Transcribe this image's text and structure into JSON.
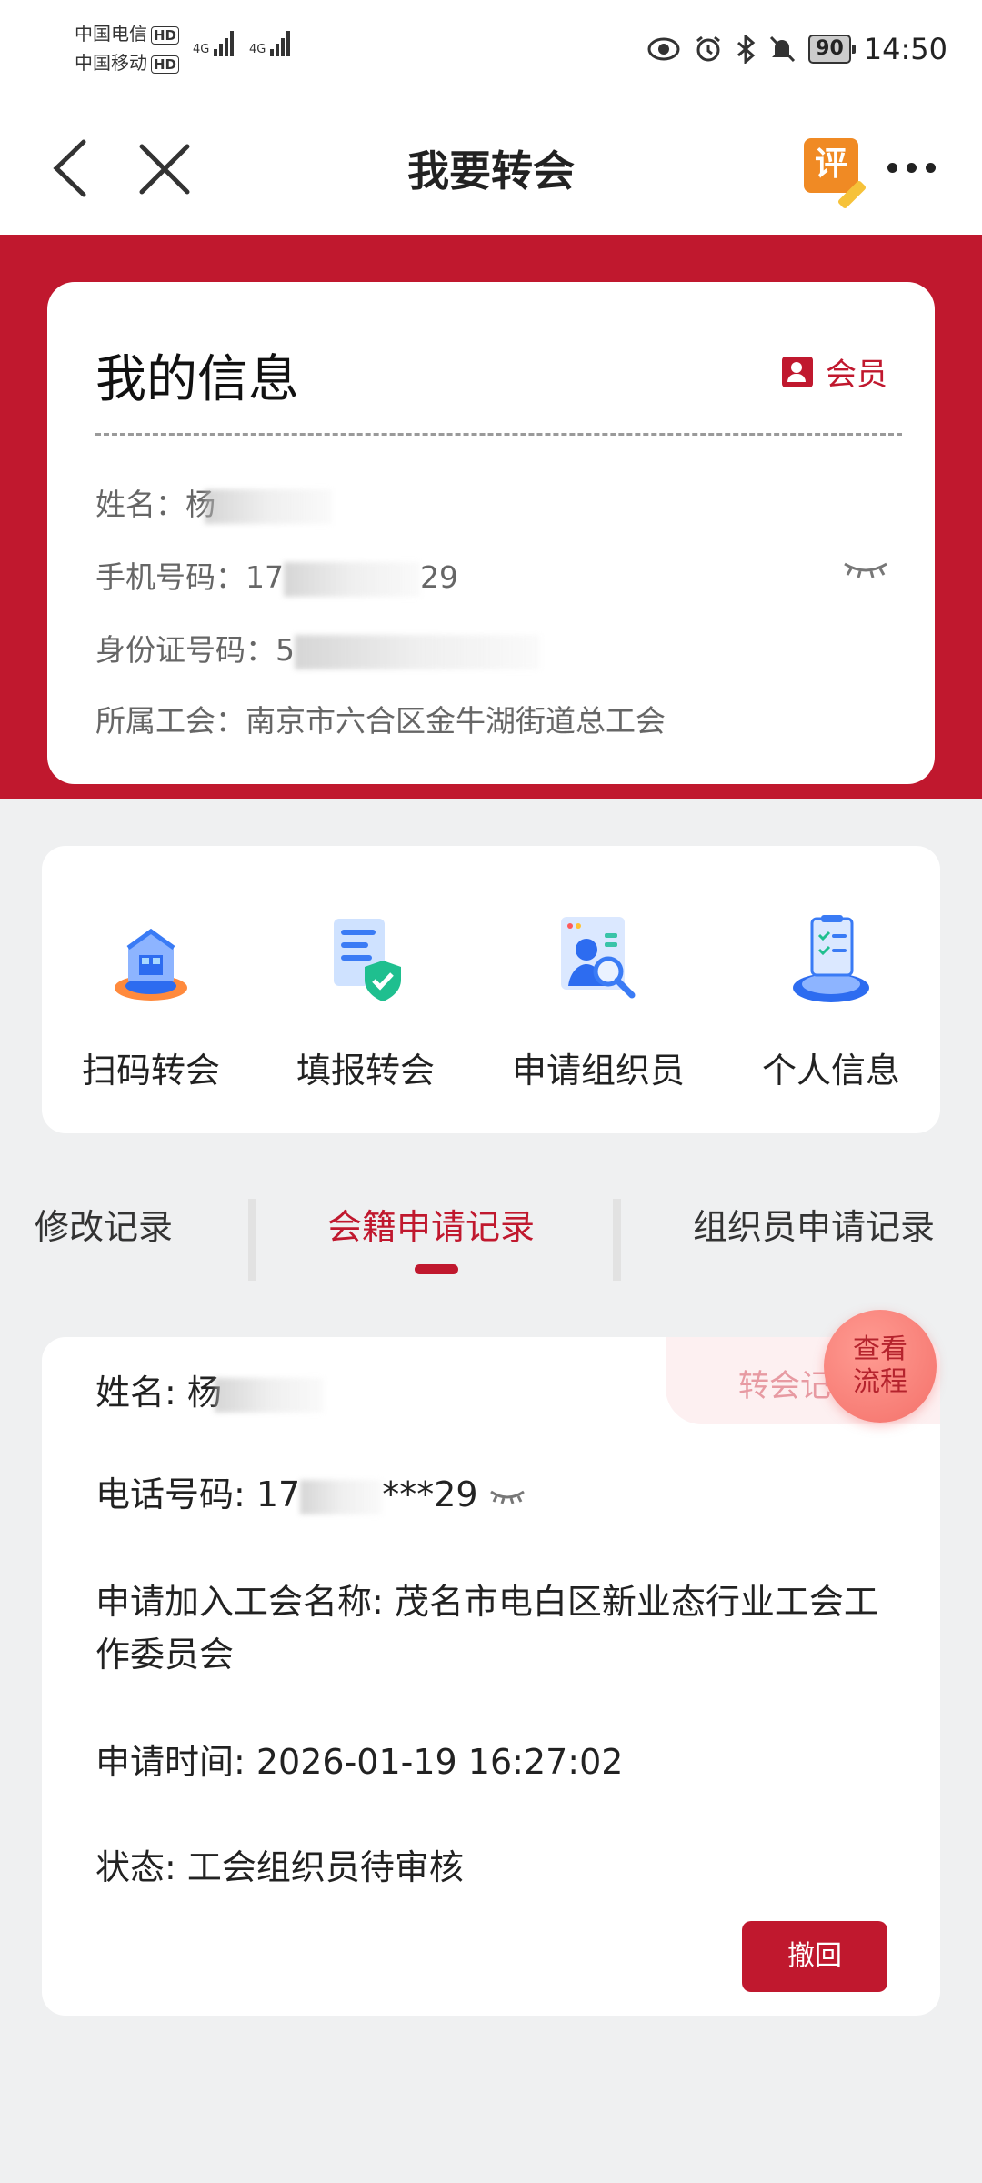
{
  "status_bar": {
    "carrier1": "中国电信",
    "carrier2": "中国移动",
    "hd": "HD",
    "network": "4G",
    "battery": "90",
    "time": "14:50"
  },
  "nav": {
    "title": "我要转会",
    "rate_label": "评"
  },
  "info": {
    "title": "我的信息",
    "badge": "会员",
    "name_label": "姓名：",
    "name_value": "杨",
    "phone_label": "手机号码：",
    "phone_prefix": "17",
    "phone_suffix": "29",
    "id_label": "身份证号码：",
    "id_prefix": "5",
    "union_label": "所属工会：",
    "union_value": "南京市六合区金牛湖街道总工会"
  },
  "actions": [
    {
      "label": "扫码转会",
      "icon": "scan-house-icon"
    },
    {
      "label": "填报转会",
      "icon": "document-shield-icon"
    },
    {
      "label": "申请组织员",
      "icon": "person-search-icon"
    },
    {
      "label": "个人信息",
      "icon": "clipboard-stand-icon"
    }
  ],
  "tabs": {
    "modify": "修改记录",
    "membership": "会籍申请记录",
    "organizer": "组织员申请记录"
  },
  "record": {
    "name": "姓名: 杨",
    "phone": "电话号码: 17",
    "phone_masked": "***29",
    "union": "申请加入工会名称: 茂名市电白区新业态行业工会工作委员会",
    "time": "申请时间: 2026-01-19 16:27:02",
    "status": "状态: 工会组织员待审核",
    "type_tag": "转会记",
    "revoke": "撤回"
  },
  "flow_button": {
    "line1": "查看",
    "line2": "流程"
  },
  "colors": {
    "brand_red": "#c0182e",
    "page_bg": "#eff0f1"
  }
}
